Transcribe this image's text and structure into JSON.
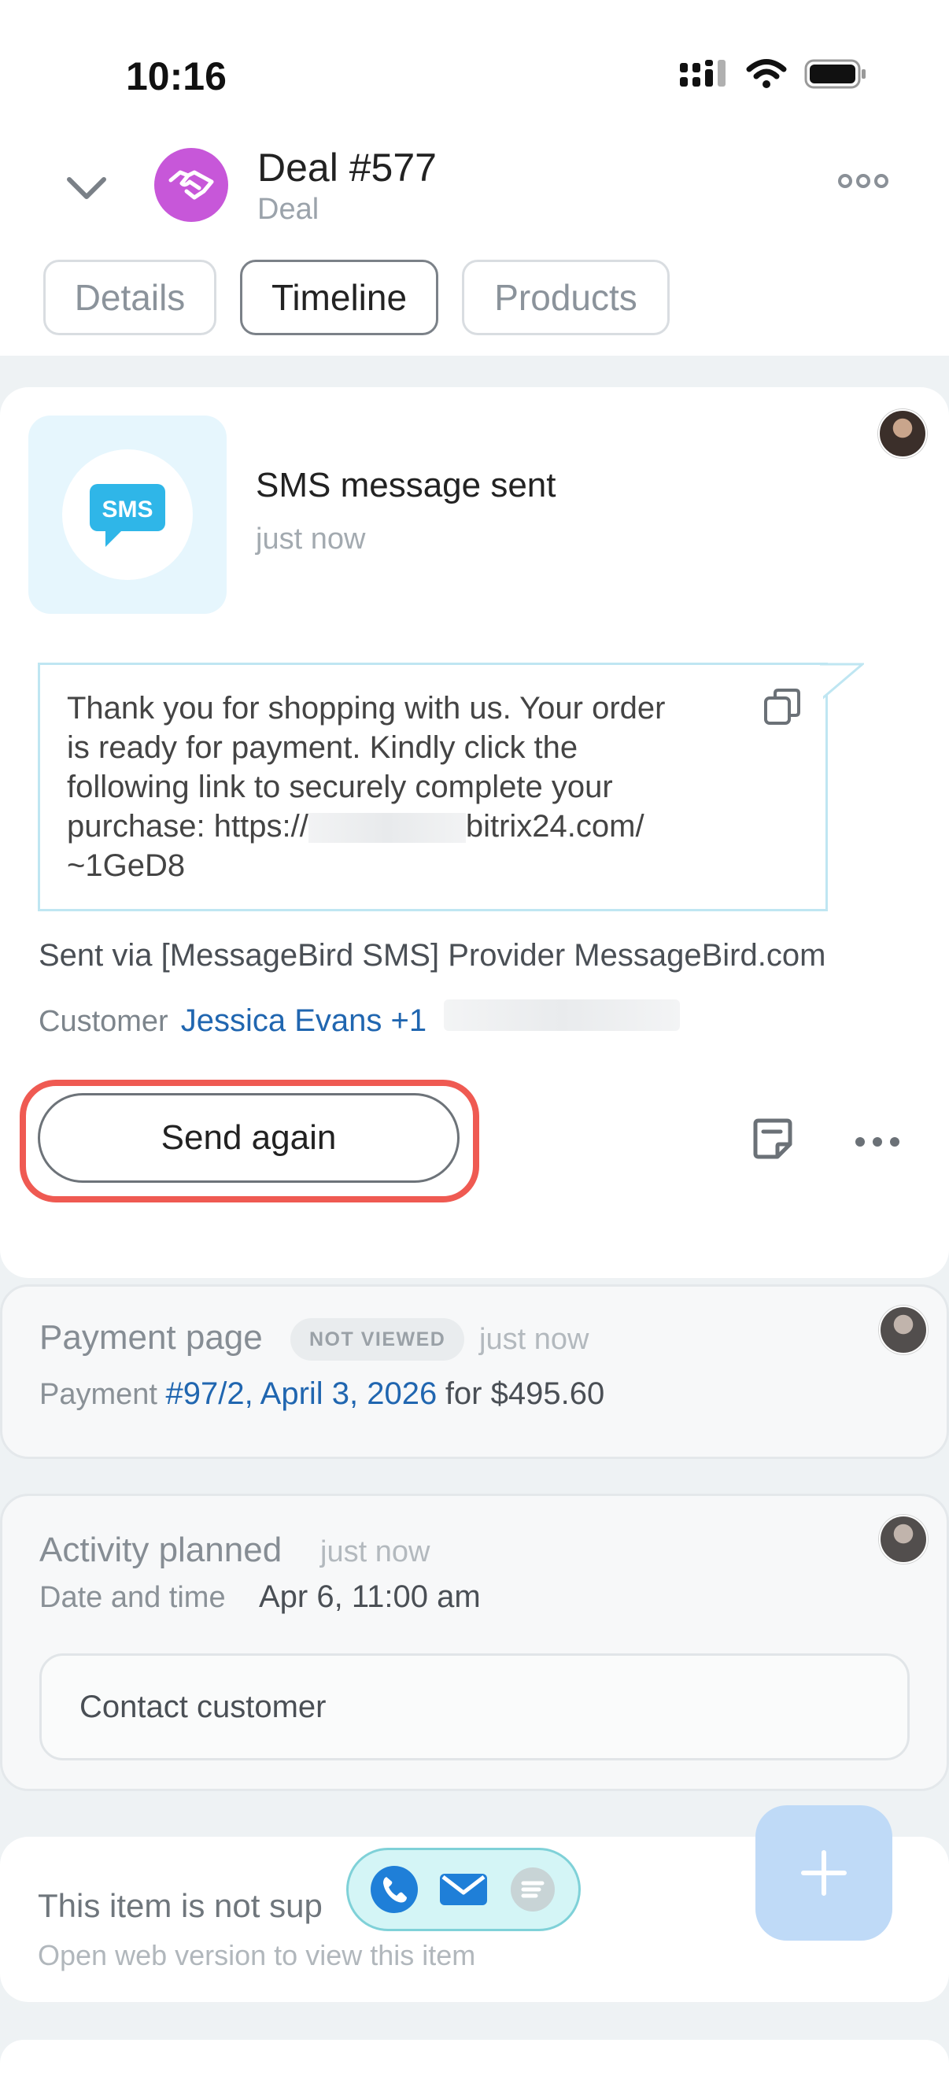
{
  "status_bar": {
    "time": "10:16"
  },
  "header": {
    "title": "Deal #577",
    "subtitle": "Deal"
  },
  "tabs": [
    {
      "label": "Details"
    },
    {
      "label": "Timeline",
      "active": true
    },
    {
      "label": "Products"
    }
  ],
  "sms_card": {
    "icon_text": "SMS",
    "title": "SMS message sent",
    "time": "just now",
    "message_line1": "Thank you for shopping with us. Your order",
    "message_line2": "is ready for payment. Kindly click the",
    "message_line3": "following link to securely complete your",
    "message_line4_start": "purchase: https://",
    "message_line4_end": "bitrix24.com/",
    "message_line5": "~1GeD8",
    "sent_via": "Sent via [MessageBird SMS] Provider MessageBird.com",
    "customer_label": "Customer",
    "customer_value": "Jessica Evans +1",
    "send_again_label": "Send again"
  },
  "payment_card": {
    "title": "Payment page",
    "badge": "NOT VIEWED",
    "time": "just now",
    "prefix": "Payment",
    "link": "#97/2, April 3, 2026",
    "amount": "for $495.60"
  },
  "activity_card": {
    "title": "Activity planned",
    "time": "just now",
    "date_label": "Date and time",
    "date_value": "Apr 6, 11:00 am",
    "task": "Contact customer"
  },
  "unsupported_card": {
    "title": "This item is not sup",
    "subtitle": "Open web version to view this item"
  },
  "colors": {
    "accent_blue": "#2066b0",
    "highlight_red": "#ef5a52",
    "deal_purple": "#c757d9",
    "sms_blue": "#2fb6e8"
  }
}
